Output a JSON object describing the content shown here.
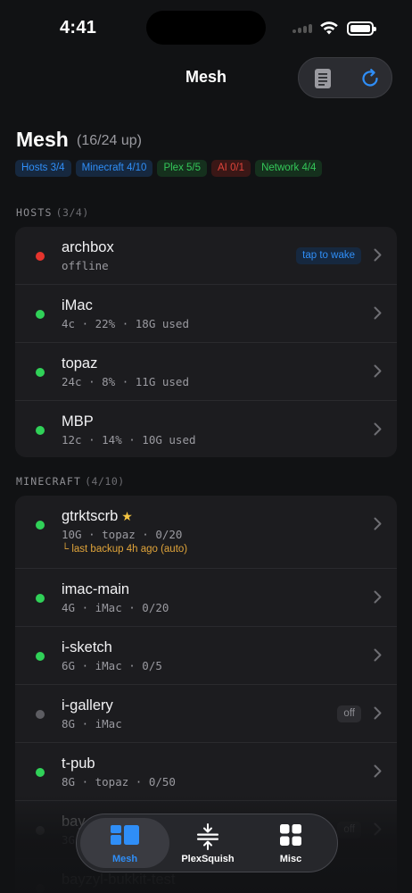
{
  "status_bar": {
    "time": "4:41"
  },
  "nav": {
    "title": "Mesh"
  },
  "header": {
    "title": "Mesh",
    "subtitle": "(16/24 up)"
  },
  "chips": [
    {
      "label": "Hosts 3/4",
      "color": "#2f8ef7",
      "bg": "#16283f"
    },
    {
      "label": "Minecraft 4/10",
      "color": "#2f8ef7",
      "bg": "#16283f"
    },
    {
      "label": "Plex 5/5",
      "color": "#34c759",
      "bg": "#15301d"
    },
    {
      "label": "AI 0/1",
      "color": "#e0443a",
      "bg": "#3a1716"
    },
    {
      "label": "Network 4/4",
      "color": "#34c759",
      "bg": "#15301d"
    }
  ],
  "hosts": {
    "heading": "HOSTS",
    "count": "(3/4)",
    "items": [
      {
        "name": "archbox",
        "sub": "offline",
        "status": "red",
        "tag": "tap to wake"
      },
      {
        "name": "iMac",
        "sub": "4c · 22% · 18G used",
        "status": "green"
      },
      {
        "name": "topaz",
        "sub": "24c · 8% · 11G used",
        "status": "green"
      },
      {
        "name": "MBP",
        "sub": "12c · 14% · 10G used",
        "status": "green"
      }
    ]
  },
  "minecraft": {
    "heading": "MINECRAFT",
    "count": "(4/10)",
    "items": [
      {
        "name": "gtrktscrb",
        "sub": "10G · topaz · 0/20",
        "status": "green",
        "note": "└ last backup 4h ago (auto)"
      },
      {
        "name": "imac-main",
        "sub": "4G · iMac · 0/20",
        "status": "green"
      },
      {
        "name": "i-sketch",
        "sub": "6G · iMac · 0/5",
        "status": "green"
      },
      {
        "name": "i-gallery",
        "sub": "8G · iMac",
        "status": "grey",
        "tag": "off"
      },
      {
        "name": "t-pub",
        "sub": "8G · topaz · 0/50",
        "status": "green"
      },
      {
        "name": "bay",
        "sub": "3G",
        "status": "grey",
        "tag": "off"
      },
      {
        "name": "bayzyl-bukkit-test",
        "sub": "",
        "status": "grey"
      }
    ]
  },
  "tabbar": {
    "tabs": [
      {
        "label": "Mesh"
      },
      {
        "label": "PlexSquish"
      },
      {
        "label": "Misc"
      }
    ]
  },
  "colors": {
    "green": "#30d158",
    "red": "#e5342d",
    "grey": "#6e6e73",
    "accent": "#2f8ef7"
  }
}
